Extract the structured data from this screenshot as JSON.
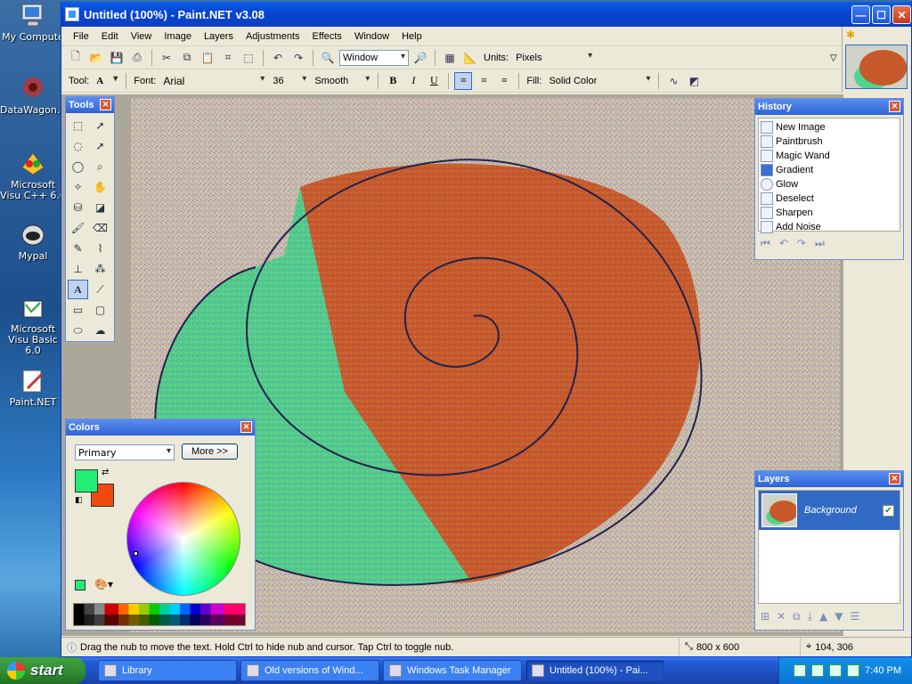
{
  "desktop": {
    "icons": [
      {
        "label": "My Compute",
        "icon": "computer-icon"
      },
      {
        "label": "DataWagon...",
        "icon": "datawagon-icon"
      },
      {
        "label": "Microsoft Visu C++ 6.0",
        "icon": "visual-cpp-icon"
      },
      {
        "label": "Mypal",
        "icon": "mypal-icon"
      },
      {
        "label": "Microsoft Visu Basic 6.0",
        "icon": "visual-basic-icon"
      },
      {
        "label": "Paint.NET",
        "icon": "paintnet-icon"
      }
    ]
  },
  "window": {
    "title": "Untitled (100%) - Paint.NET v3.08",
    "controls": {
      "minimize": "—",
      "maximize": "☐",
      "close": "✕"
    }
  },
  "menu": [
    "File",
    "Edit",
    "View",
    "Image",
    "Layers",
    "Adjustments",
    "Effects",
    "Window",
    "Help"
  ],
  "toolbar": {
    "zoom_mode": "Window",
    "units_label": "Units:",
    "units_value": "Pixels"
  },
  "text_toolbar": {
    "tool_label": "Tool:",
    "tool_value": "A",
    "font_label": "Font:",
    "font_value": "Arial",
    "size_value": "36",
    "antialias_value": "Smooth",
    "bold": "B",
    "italic": "I",
    "underline": "U",
    "fill_label": "Fill:",
    "fill_value": "Solid Color"
  },
  "tools_panel": {
    "title": "Tools",
    "active_tool_glyph": "A"
  },
  "history_panel": {
    "title": "History",
    "items": [
      "New Image",
      "Paintbrush",
      "Magic Wand",
      "Gradient",
      "Glow",
      "Deselect",
      "Sharpen",
      "Add Noise"
    ]
  },
  "layers_panel": {
    "title": "Layers",
    "layers": [
      {
        "name": "Background",
        "visible": true
      }
    ]
  },
  "colors_panel": {
    "title": "Colors",
    "mode": "Primary",
    "more_button": "More >>",
    "primary_color": "#22ee77",
    "secondary_color": "#f04a10"
  },
  "status": {
    "hint": "Drag the nub to move the text. Hold Ctrl to hide nub and cursor. Tap Ctrl to toggle nub.",
    "image_size": "800 x 600",
    "cursor_pos": "104, 306"
  },
  "taskbar": {
    "start_label": "start",
    "tasks": [
      {
        "label": "Library",
        "active": false
      },
      {
        "label": "Old versions of Wind...",
        "active": false
      },
      {
        "label": "Windows Task Manager",
        "active": false
      },
      {
        "label": "Untitled (100%) - Pai...",
        "active": true
      }
    ],
    "clock": "7:40 PM"
  }
}
